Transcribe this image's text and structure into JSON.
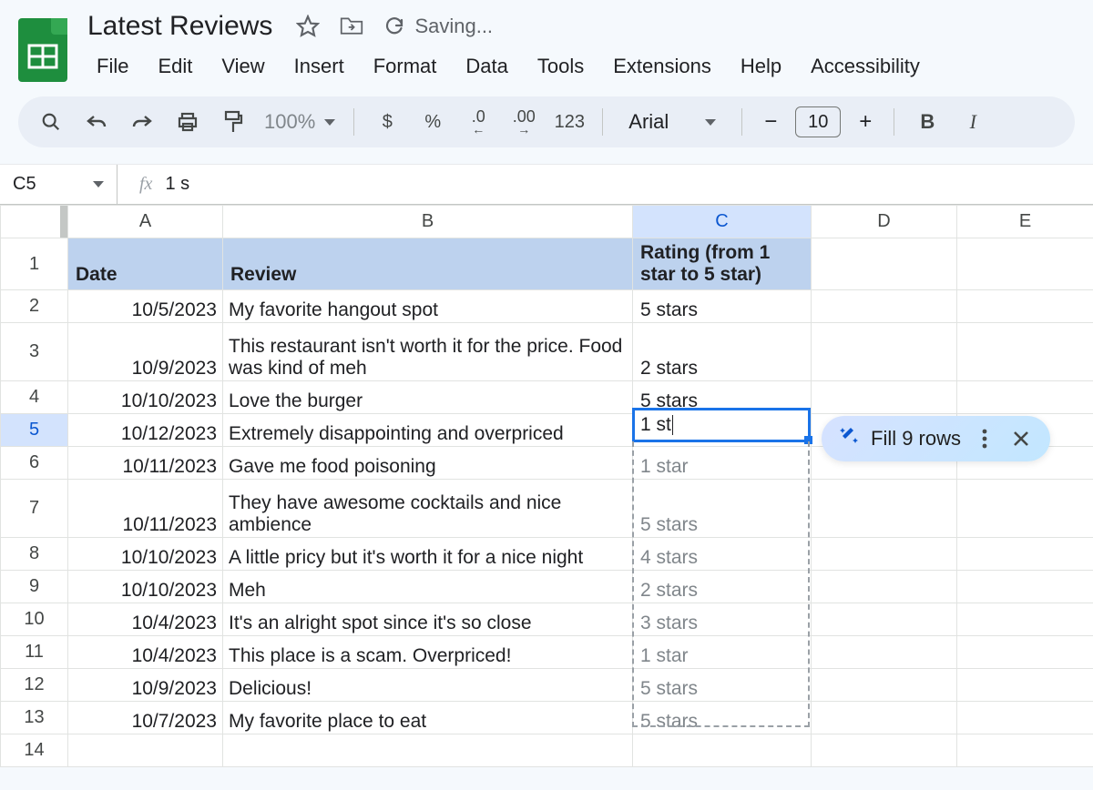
{
  "doc": {
    "title": "Latest Reviews",
    "saving_label": "Saving..."
  },
  "menus": [
    "File",
    "Edit",
    "View",
    "Insert",
    "Format",
    "Data",
    "Tools",
    "Extensions",
    "Help",
    "Accessibility"
  ],
  "toolbar": {
    "zoom": "100%",
    "currency": "$",
    "percent": "%",
    "dec_dec": ".0",
    "inc_dec": ".00",
    "numfmt": "123",
    "font": "Arial",
    "font_size": "10",
    "bold": "B",
    "italic": "I"
  },
  "fx": {
    "cell": "C5",
    "label": "fx",
    "value": "1 s"
  },
  "columns": [
    "A",
    "B",
    "C",
    "D",
    "E"
  ],
  "selected_column": "C",
  "selected_row": 5,
  "headers": {
    "A": "Date",
    "B": "Review",
    "C": "Rating (from 1 star to 5 star)"
  },
  "rows": [
    {
      "n": 2,
      "date": "10/5/2023",
      "review": "My favorite hangout spot",
      "rating": "5 stars",
      "ghost": false,
      "tall": false
    },
    {
      "n": 3,
      "date": "10/9/2023",
      "review": "This restaurant isn't worth it for the price. Food was kind of meh",
      "rating": "2 stars",
      "ghost": false,
      "tall": true
    },
    {
      "n": 4,
      "date": "10/10/2023",
      "review": "Love the burger",
      "rating": "5 stars",
      "ghost": false,
      "tall": false
    },
    {
      "n": 5,
      "date": "10/12/2023",
      "review": "Extremely disappointing and overpriced",
      "rating": "",
      "ghost": false,
      "tall": false
    },
    {
      "n": 6,
      "date": "10/11/2023",
      "review": "Gave me food poisoning",
      "rating": "1 star",
      "ghost": true,
      "tall": false
    },
    {
      "n": 7,
      "date": "10/11/2023",
      "review": "They have awesome cocktails and nice ambience",
      "rating": "5 stars",
      "ghost": true,
      "tall": true
    },
    {
      "n": 8,
      "date": "10/10/2023",
      "review": "A little pricy but it's worth it for a nice night",
      "rating": "4 stars",
      "ghost": true,
      "tall": false
    },
    {
      "n": 9,
      "date": "10/10/2023",
      "review": "Meh",
      "rating": "2 stars",
      "ghost": true,
      "tall": false
    },
    {
      "n": 10,
      "date": "10/4/2023",
      "review": "It's an alright spot since it's so close",
      "rating": "3 stars",
      "ghost": true,
      "tall": false
    },
    {
      "n": 11,
      "date": "10/4/2023",
      "review": "This place is a scam. Overpriced!",
      "rating": "1 star",
      "ghost": true,
      "tall": false
    },
    {
      "n": 12,
      "date": "10/9/2023",
      "review": "Delicious!",
      "rating": "5 stars",
      "ghost": true,
      "tall": false
    },
    {
      "n": 13,
      "date": "10/7/2023",
      "review": "My favorite place to eat",
      "rating": "5 stars",
      "ghost": true,
      "tall": false
    },
    {
      "n": 14,
      "date": "",
      "review": "",
      "rating": "",
      "ghost": false,
      "tall": false
    }
  ],
  "active_cell_value": "1 st",
  "smart_chip": {
    "label": "Fill 9 rows"
  }
}
